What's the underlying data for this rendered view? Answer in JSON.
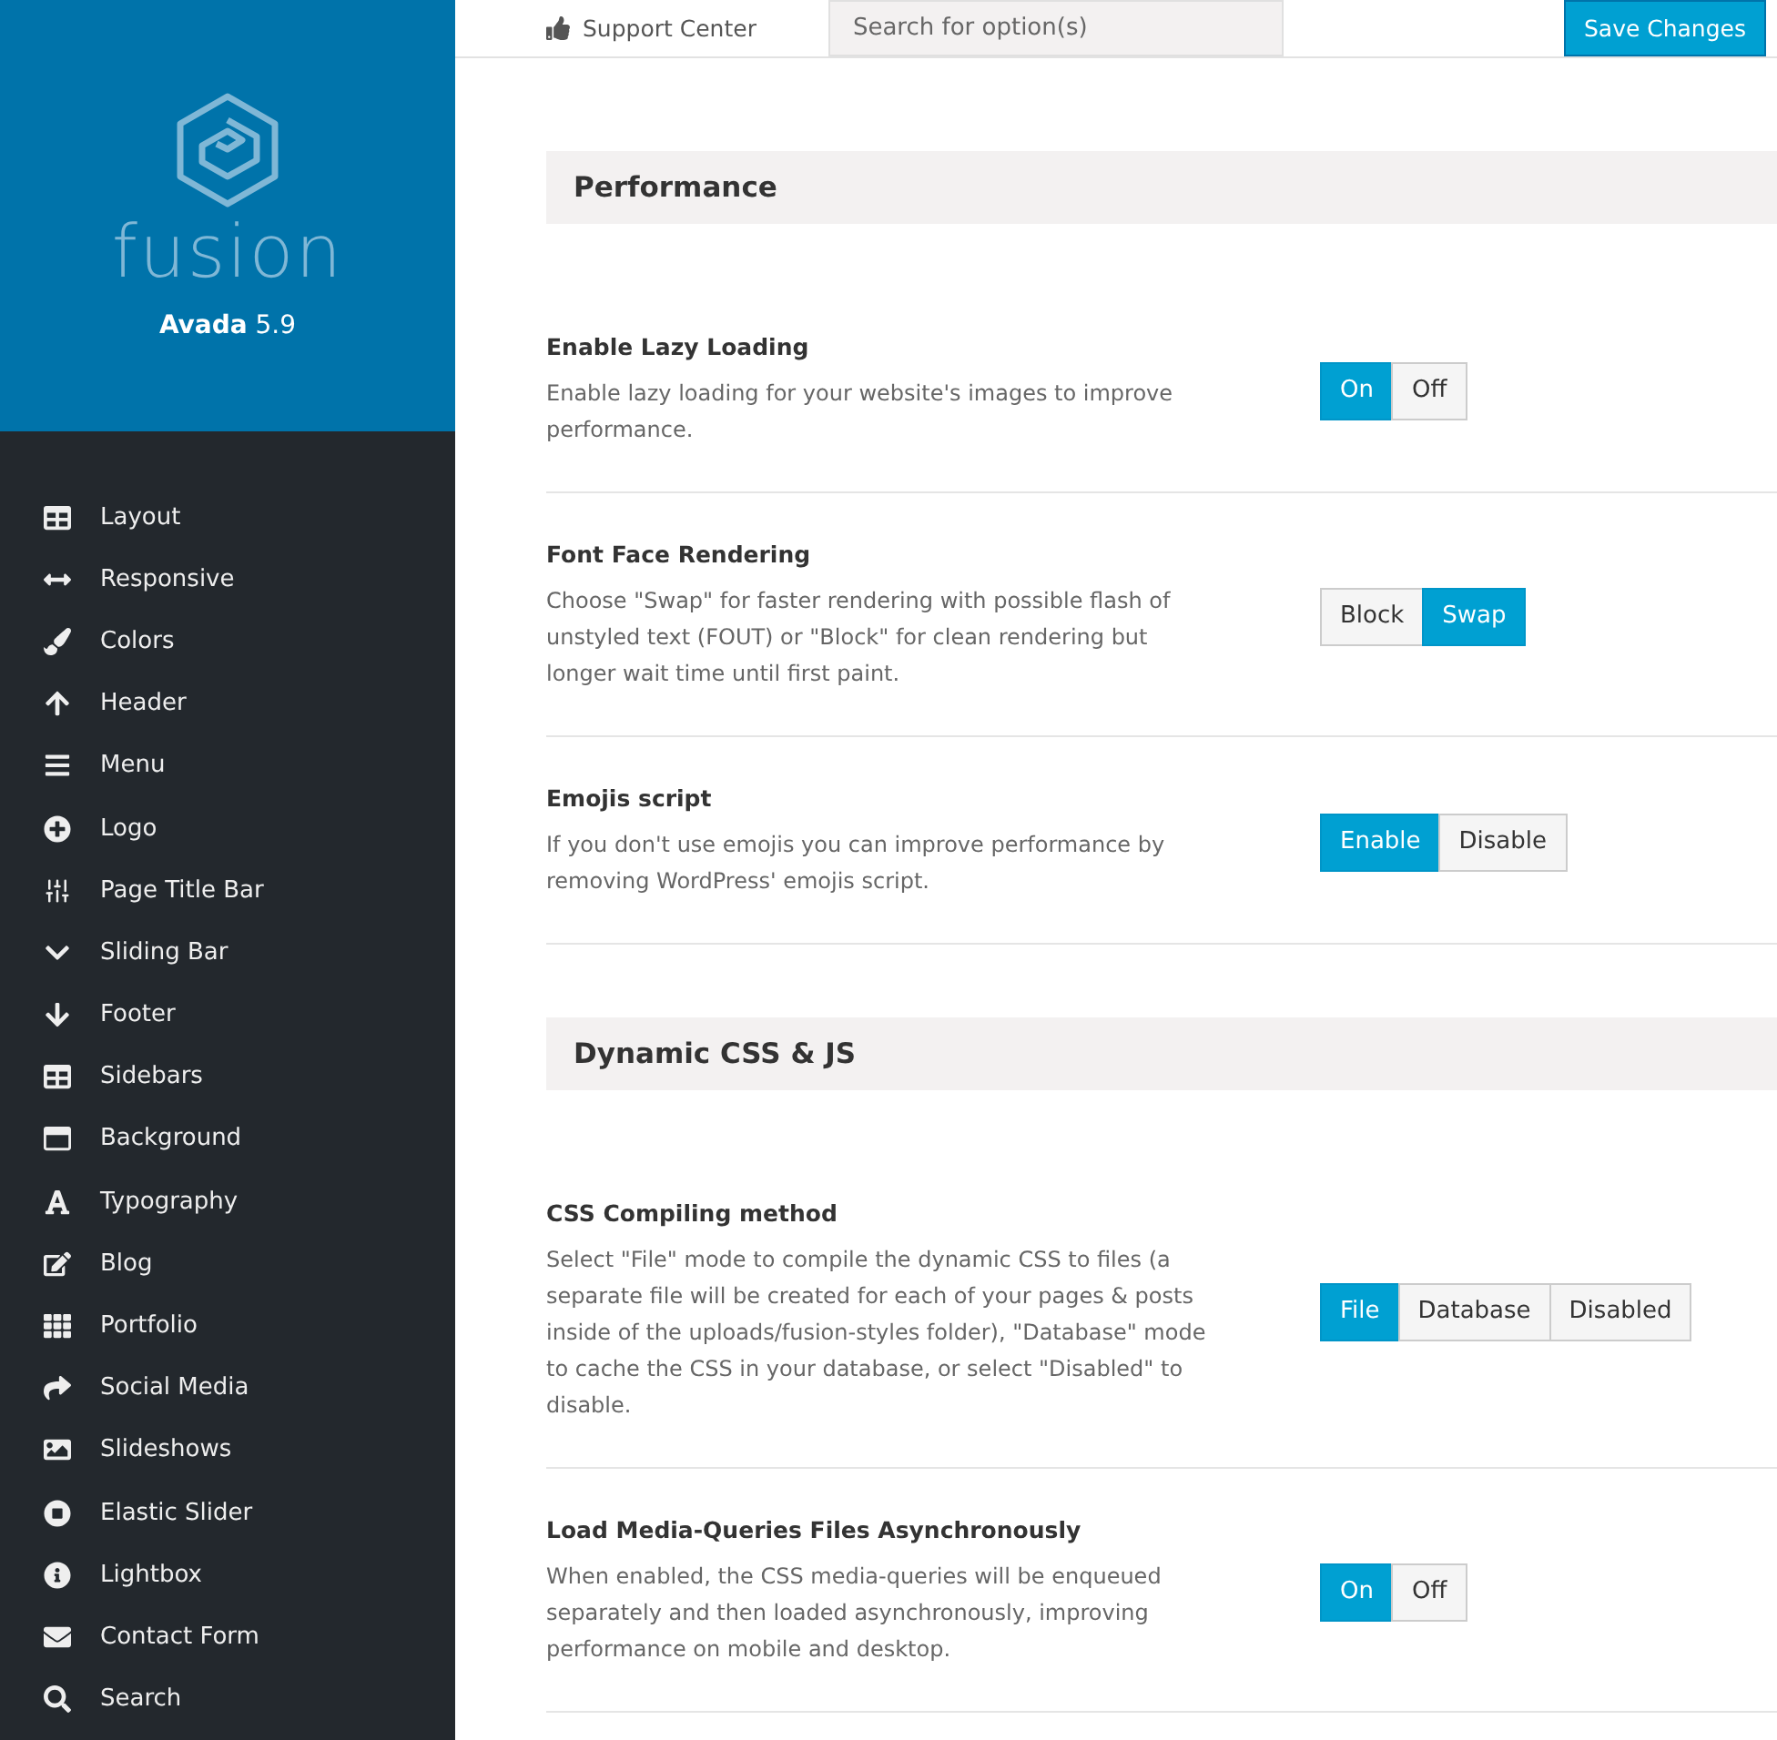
{
  "brand": {
    "logo_text": "fusion",
    "product": "**Avada** 5.9"
  },
  "sidebar": {
    "items": [
      {
        "label": "Layout",
        "selected": false
      },
      {
        "label": "Responsive",
        "selected": false
      },
      {
        "label": "Colors",
        "selected": false
      },
      {
        "label": "Header",
        "selected": false
      },
      {
        "label": "Menu",
        "selected": false
      },
      {
        "label": "Logo",
        "selected": false
      },
      {
        "label": "Page Title Bar",
        "selected": false
      },
      {
        "label": "Sliding Bar",
        "selected": false
      },
      {
        "label": "Footer",
        "selected": false
      },
      {
        "label": "Sidebars",
        "selected": false
      },
      {
        "label": "Background",
        "selected": false
      },
      {
        "label": "Typography",
        "selected": false
      },
      {
        "label": "Blog",
        "selected": false
      },
      {
        "label": "Portfolio",
        "selected": false
      },
      {
        "label": "Social Media",
        "selected": false
      },
      {
        "label": "Slideshows",
        "selected": false
      },
      {
        "label": "Elastic Slider",
        "selected": false
      },
      {
        "label": "Lightbox",
        "selected": false
      },
      {
        "label": "Contact Form",
        "selected": false
      },
      {
        "label": "Search",
        "selected": false
      }
    ]
  },
  "toolbar": {
    "support_link": "Support Center",
    "search": {
      "placeholder": "Search for option(s)"
    },
    "save_button": "Save Changes"
  },
  "sections": [
    {
      "title": "Performance",
      "options": [
        {
          "title": "Enable Lazy Loading",
          "description": "Enable lazy loading for your website's images to improve performance.",
          "choices": [
            {
              "label": "On",
              "selected": true
            },
            {
              "label": "Off",
              "selected": false
            }
          ]
        },
        {
          "title": "Font Face Rendering",
          "description": "Choose \"Swap\" for faster rendering with possible flash of unstyled text (FOUT) or \"Block\" for clean rendering but longer wait time until first paint.",
          "choices": [
            {
              "label": "Block",
              "selected": false
            },
            {
              "label": "Swap",
              "selected": true
            }
          ]
        },
        {
          "title": "Emojis script",
          "description": "If you don't use emojis you can improve performance by removing WordPress' emojis script.",
          "choices": [
            {
              "label": "Enable",
              "selected": true
            },
            {
              "label": "Disable",
              "selected": false
            }
          ]
        }
      ]
    },
    {
      "title": "Dynamic CSS & JS",
      "options": [
        {
          "title": "CSS Compiling method",
          "description": "Select \"File\" mode to compile the dynamic CSS to files (a separate file will be created for each of your pages & posts inside of the uploads/fusion-styles folder), \"Database\" mode to cache the CSS in your database, or select \"Disabled\" to disable.",
          "choices": [
            {
              "label": "File",
              "selected": true
            },
            {
              "label": "Database",
              "selected": false
            },
            {
              "label": "Disabled",
              "selected": false
            }
          ]
        },
        {
          "title": "Load Media-Queries Files Asynchronously",
          "description": "When enabled, the CSS media-queries will be enqueued separately and then loaded asynchronously, improving performance on mobile and desktop.",
          "choices": [
            {
              "label": "On",
              "selected": true
            },
            {
              "label": "Off",
              "selected": false
            }
          ]
        }
      ]
    }
  ]
}
